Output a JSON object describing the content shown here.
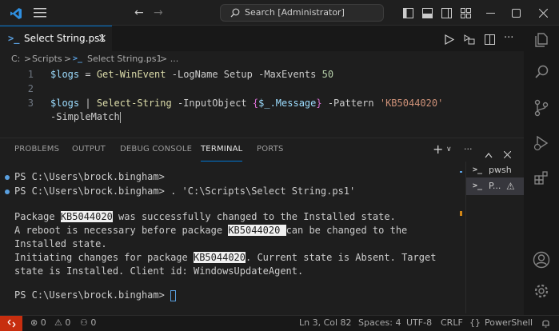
{
  "titlebar": {
    "search_text": "Search [Administrator]",
    "icons": [
      "vscode-logo-icon",
      "menu-icon",
      "back-arrow-icon",
      "forward-arrow-icon",
      "search-icon",
      "layout-sidebar-left-icon",
      "layout-panel-icon",
      "layout-sidebar-right-icon",
      "customize-layout-icon",
      "minimize-icon",
      "maximize-icon",
      "close-icon"
    ]
  },
  "tab": {
    "label": "Select String.ps1",
    "close": "×"
  },
  "breadcrumb": {
    "c": "C:",
    "sep": ">",
    "folder": "Scripts",
    "file": "Select String.ps1",
    "more": "> ..."
  },
  "editor": {
    "lines": [
      {
        "num": "1"
      },
      {
        "num": "2"
      },
      {
        "num": "3"
      }
    ],
    "l1": {
      "var": "$logs",
      "eq": " = ",
      "cmd": "Get-WinEvent",
      "p1": " -LogName Setup -MaxEvents ",
      "n": "50"
    },
    "l3": {
      "var": "$logs",
      "pipe": " | ",
      "cmd": "Select-String",
      "p1": " -InputObject ",
      "b1": "{",
      "v2": "$_",
      "p2": ".Message",
      "b2": "}",
      "p3": " -Pattern ",
      "s": "'KB5044020'"
    },
    "l3b": {
      "p": "-SimpleMatch"
    }
  },
  "panel": {
    "tabs": [
      "PROBLEMS",
      "OUTPUT",
      "DEBUG CONSOLE",
      "TERMINAL",
      "PORTS"
    ],
    "active": "TERMINAL"
  },
  "terminal": {
    "line1": "PS C:\\Users\\brock.bingham>",
    "line2": "PS C:\\Users\\brock.bingham> . 'C:\\Scripts\\Select String.ps1'",
    "line4a": "Package ",
    "kb": "KB5044020",
    "line4b": " was successfully changed to the Installed state.",
    "line5a": "A reboot is necessary before package ",
    "kb2": "KB5044020 ",
    "line5b": "can be changed to the",
    "line6": "Installed state.",
    "line7a": "Initiating changes for package ",
    "kb3": "KB5044020",
    "line7b": ". Current state is Absent. Target",
    "line8": "state is Installed. Client id: WindowsUpdateAgent.",
    "line10": "PS C:\\Users\\brock.bingham> "
  },
  "termlist": {
    "items": [
      "pwsh",
      "P..."
    ]
  },
  "statusbar": {
    "errors": "0",
    "warnings": "0",
    "ports": "0",
    "position": "Ln 3, Col 82",
    "spaces": "Spaces: 4",
    "encoding": "UTF-8",
    "eol": "CRLF",
    "language": "PowerShell"
  },
  "colors": {
    "accent": "#0078d4",
    "remote": "#c72e0f"
  }
}
